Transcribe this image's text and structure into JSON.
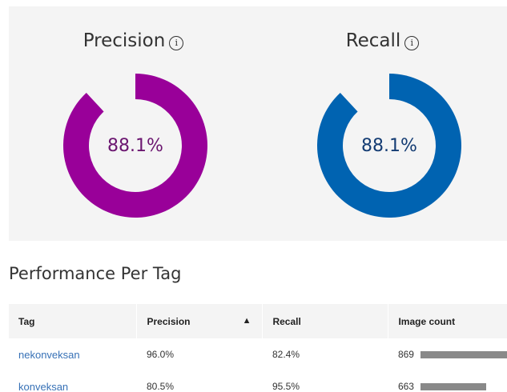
{
  "metrics": {
    "precision": {
      "title": "Precision",
      "value": 0.881,
      "display": "88.1%",
      "color": "#990099",
      "text_color": "#6b1670"
    },
    "recall": {
      "title": "Recall",
      "value": 0.881,
      "display": "88.1%",
      "color": "#0063b1",
      "text_color": "#143c73"
    },
    "info_glyph": "i"
  },
  "performance": {
    "title": "Performance Per Tag",
    "columns": [
      "Tag",
      "Precision",
      "Recall",
      "Image count"
    ],
    "sort_indicator": "▲",
    "max_count": 869,
    "rows": [
      {
        "tag": "nekonveksan",
        "precision": "96.0%",
        "recall": "82.4%",
        "count": "869",
        "count_value": 869
      },
      {
        "tag": "konveksan",
        "precision": "80.5%",
        "recall": "95.5%",
        "count": "663",
        "count_value": 663
      }
    ]
  }
}
